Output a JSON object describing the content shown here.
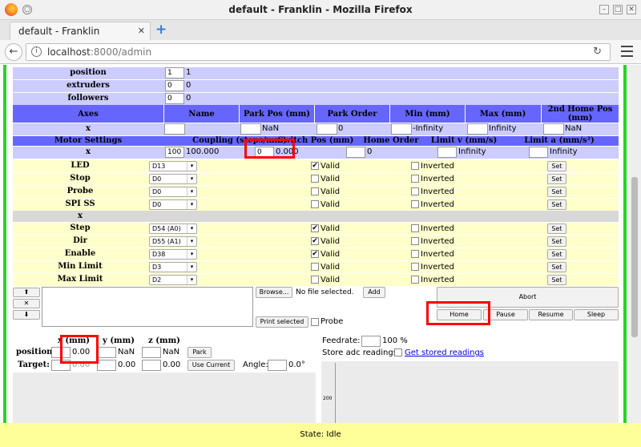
{
  "window": {
    "title": "default - Franklin - Mozilla Firefox"
  },
  "tab": {
    "label": "default - Franklin"
  },
  "nav": {
    "url_host": "localhost",
    "url_rest": ":8000/admin"
  },
  "general": [
    {
      "label": "position",
      "value": "1",
      "extra": "1"
    },
    {
      "label": "extruders",
      "value": "0",
      "extra": "0"
    },
    {
      "label": "followers",
      "value": "0",
      "extra": "0"
    }
  ],
  "axes": {
    "headers": [
      "Axes",
      "Name",
      "Park Pos (mm)",
      "Park Order",
      "Min (mm)",
      "Max (mm)",
      "2nd Home Pos (mm)"
    ],
    "row": {
      "label": "x",
      "park_pos_extra": "NaN",
      "park_order_extra": "0",
      "min_extra": "-Infinity",
      "max_extra": "Infinity",
      "home2_extra": "NaN"
    }
  },
  "motor": {
    "headers": [
      "Motor Settings",
      "Coupling (steps/mm)",
      "Switch Pos (mm)",
      "Home Order",
      "Limit v (mm/s)",
      "Limit a (mm/s²)"
    ],
    "row": {
      "label": "x",
      "coupling": "100",
      "coupling_extra": "100.000",
      "switch": "0",
      "switch_extra": "0.000",
      "home_order_extra": "0",
      "limit_v_extra": "Infinity",
      "limit_a_extra": "Infinity"
    }
  },
  "pins_common": [
    {
      "label": "LED",
      "pin": "D13",
      "valid": true
    },
    {
      "label": "Stop",
      "pin": "D0",
      "valid": false
    },
    {
      "label": "Probe",
      "pin": "D0",
      "valid": false
    },
    {
      "label": "SPI SS",
      "pin": "D0",
      "valid": false
    }
  ],
  "section_x": "x",
  "pins_x": [
    {
      "label": "Step",
      "pin": "D54 (A0)",
      "valid": true
    },
    {
      "label": "Dir",
      "pin": "D55 (A1)",
      "valid": true
    },
    {
      "label": "Enable",
      "pin": "D38",
      "valid": true
    },
    {
      "label": "Min Limit",
      "pin": "D3",
      "valid": false
    },
    {
      "label": "Max Limit",
      "pin": "D2",
      "valid": false
    }
  ],
  "pin_labels": {
    "valid": "Valid",
    "inverted": "Inverted",
    "set": "Set"
  },
  "file": {
    "up": "⬆",
    "remove": "✕",
    "down": "⬇",
    "browse": "Browse...",
    "status": "No file selected.",
    "add": "Add",
    "print": "Print selected",
    "probe": "Probe"
  },
  "control": {
    "abort": "Abort",
    "home": "Home",
    "pause": "Pause",
    "resume": "Resume",
    "sleep": "Sleep"
  },
  "coords": {
    "headers": [
      "x (mm)",
      "y (mm)",
      "z (mm)"
    ],
    "position_label": "position",
    "target_label": "Target:",
    "position_values": [
      "0.00",
      "NaN",
      "NaN"
    ],
    "target_values": [
      "0.00",
      "0.00",
      "0.00"
    ],
    "park": "Park",
    "use_current": "Use Current",
    "angle_label": "Angle:",
    "angle_value": "0.0°"
  },
  "feed": {
    "label": "Feedrate:",
    "value": "100 %"
  },
  "adc": {
    "label": "Store adc readings",
    "link": "Get stored readings"
  },
  "graph": {
    "tick": "200"
  },
  "state": "State: Idle",
  "colors": {
    "lavender": "#ccccff",
    "header": "#6666ff",
    "yellow": "#ffffcc",
    "green": "#25d425",
    "highlight": "#ff0000",
    "state": "#ffff99"
  }
}
